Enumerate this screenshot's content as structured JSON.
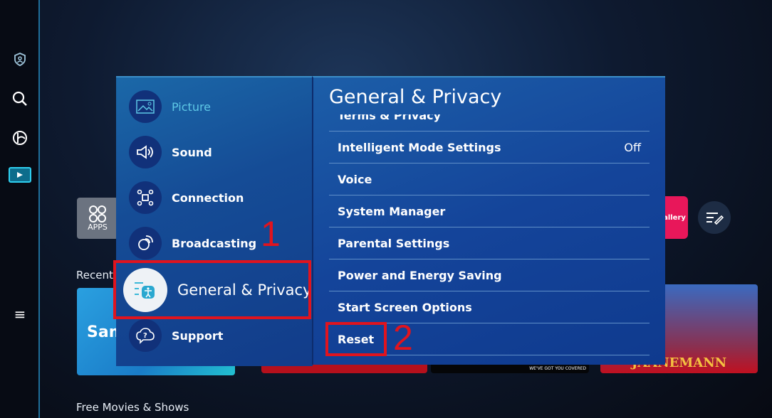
{
  "sidebar": {
    "icons": [
      "privacy-shield-icon",
      "search-icon",
      "ambient-icon",
      "media-icon",
      "menu-icon"
    ]
  },
  "home": {
    "apps_label": "APPS",
    "gallery_label": "allery",
    "recent_label": "Recent",
    "samsung_tile_text": "Sam",
    "poster_text": "JAANEMANN",
    "black_tile_text": "WE'VE GOT YOU COVERED",
    "free_label": "Free Movies & Shows"
  },
  "settings": {
    "categories": [
      {
        "label": "Picture",
        "icon": "picture-icon"
      },
      {
        "label": "Sound",
        "icon": "sound-icon"
      },
      {
        "label": "Connection",
        "icon": "connection-icon"
      },
      {
        "label": "Broadcasting",
        "icon": "broadcasting-icon"
      },
      {
        "label": "General & Privacy",
        "icon": "general-privacy-icon",
        "selected": true
      },
      {
        "label": "Support",
        "icon": "support-icon"
      }
    ],
    "title": "General & Privacy",
    "items": [
      {
        "label": "Terms & Privacy",
        "value": ""
      },
      {
        "label": "Intelligent Mode Settings",
        "value": "Off"
      },
      {
        "label": "Voice",
        "value": ""
      },
      {
        "label": "System Manager",
        "value": ""
      },
      {
        "label": "Parental Settings",
        "value": ""
      },
      {
        "label": "Power and Energy Saving",
        "value": ""
      },
      {
        "label": "Start Screen Options",
        "value": ""
      },
      {
        "label": "Reset",
        "value": ""
      }
    ]
  },
  "annotations": {
    "step1": "1",
    "step2": "2",
    "color": "#e0141e"
  }
}
